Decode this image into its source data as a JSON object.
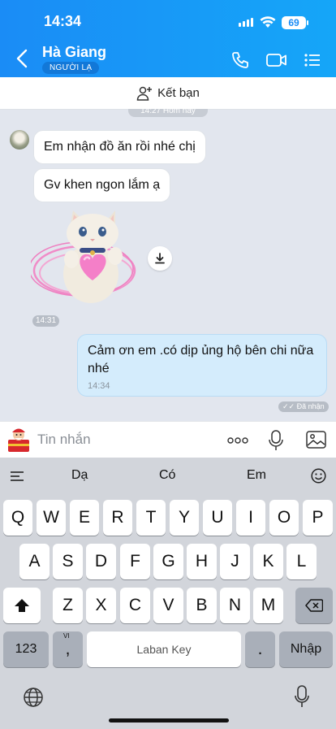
{
  "status": {
    "time": "14:34",
    "battery": "69"
  },
  "header": {
    "contact_name": "Hà Giang",
    "badge": "NGƯỜI LẠ"
  },
  "add_friend": {
    "label": "Kết bạn",
    "peek_text": "14:27 Hôm nay"
  },
  "messages": {
    "incoming": [
      "Em nhận đồ ăn rồi nhé chị",
      "Gv khen ngon lắm ạ"
    ],
    "sticker_time": "14:31",
    "outgoing_text": "Cảm ơn em .có dịp ủng hộ bên chi nữa nhé",
    "outgoing_time": "14:34",
    "seen_label": "Đã nhận"
  },
  "composer": {
    "placeholder": "Tin nhắn"
  },
  "keyboard": {
    "suggestions": [
      "Dạ",
      "Có",
      "Em"
    ],
    "row1": [
      "Q",
      "W",
      "E",
      "R",
      "T",
      "Y",
      "U",
      "I",
      "O",
      "P"
    ],
    "row2": [
      "A",
      "S",
      "D",
      "F",
      "G",
      "H",
      "J",
      "K",
      "L"
    ],
    "row3": [
      "Z",
      "X",
      "C",
      "V",
      "B",
      "N",
      "M"
    ],
    "num_key": "123",
    "comma_key": ",",
    "comma_hint": "VI",
    "space_label": "Laban Key",
    "period_key": ".",
    "return_label": "Nhập"
  }
}
